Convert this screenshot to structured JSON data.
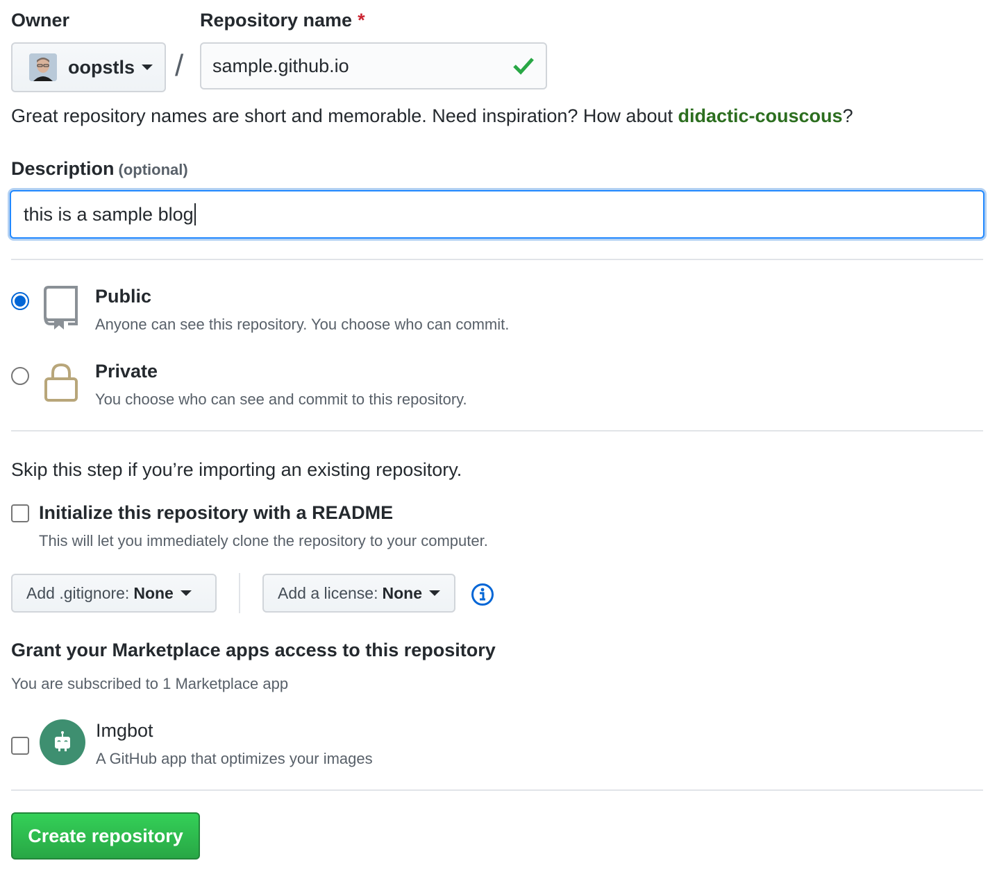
{
  "owner": {
    "label": "Owner",
    "username": "oopstls"
  },
  "repo": {
    "label": "Repository name",
    "required_mark": "*",
    "value": "sample.github.io",
    "separator": "/"
  },
  "hint": {
    "text": "Great repository names are short and memorable. Need inspiration? How about ",
    "suggestion": "didactic-couscous",
    "end": "?"
  },
  "description": {
    "label": "Description",
    "optional": "(optional)",
    "value": "this is a sample blog"
  },
  "visibility": {
    "public": {
      "title": "Public",
      "desc": "Anyone can see this repository. You choose who can commit.",
      "selected": true
    },
    "private": {
      "title": "Private",
      "desc": "You choose who can see and commit to this repository.",
      "selected": false
    }
  },
  "init": {
    "skip_text": "Skip this step if you’re importing an existing repository.",
    "readme_label": "Initialize this repository with a README",
    "readme_desc": "This will let you immediately clone the repository to your computer.",
    "readme_checked": false
  },
  "gitignore": {
    "prefix": "Add .gitignore:",
    "value": "None"
  },
  "license": {
    "prefix": "Add a license:",
    "value": "None"
  },
  "marketplace": {
    "title": "Grant your Marketplace apps access to this repository",
    "subtitle": "You are subscribed to 1 Marketplace app",
    "apps": [
      {
        "name": "Imgbot",
        "desc": "A GitHub app that optimizes your images",
        "checked": false
      }
    ]
  },
  "submit": {
    "label": "Create repository"
  },
  "colors": {
    "accent": "#0366d6",
    "success": "#28a745",
    "suggestion": "#2c6e1f",
    "lock": "#b8a67a",
    "app_logo": "#3e8f70"
  },
  "icons": [
    "avatar",
    "caret-down-icon",
    "check-icon",
    "repo-icon",
    "lock-icon",
    "info-icon",
    "imgbot-icon"
  ]
}
